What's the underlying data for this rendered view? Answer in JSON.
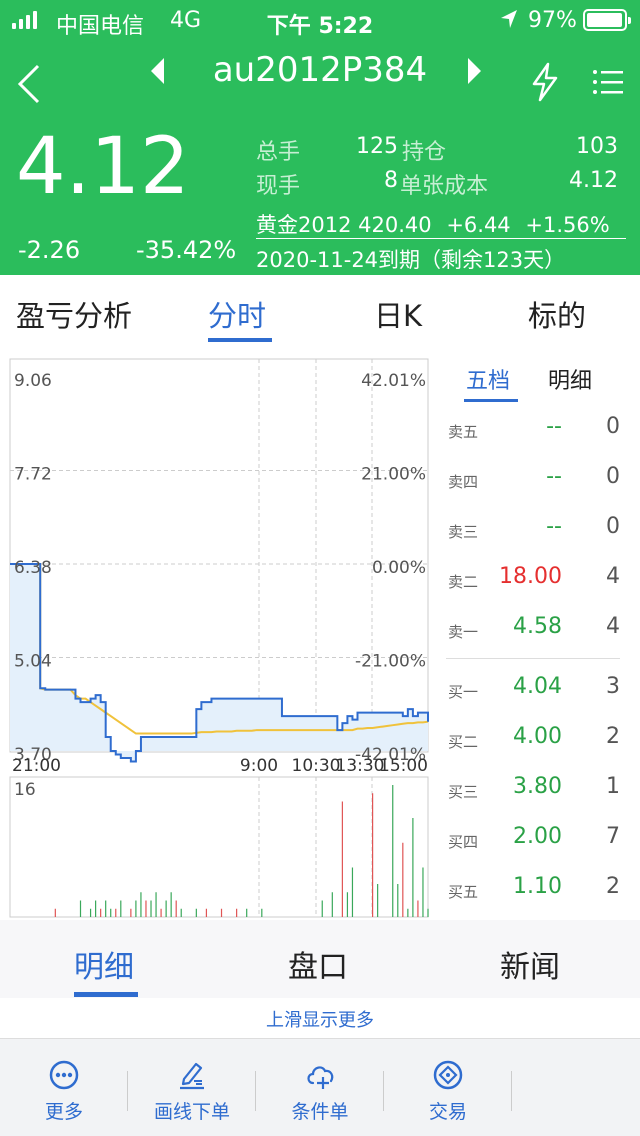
{
  "status_bar": {
    "carrier": "中国电信",
    "network": "4G",
    "time": "下午 5:22",
    "battery": "97%"
  },
  "nav": {
    "symbol": "au2012P384"
  },
  "quote": {
    "price": "4.12",
    "change": "-2.26",
    "change_pct": "-35.42%",
    "total_vol_label": "总手",
    "total_vol": "125",
    "oi_label": "持仓",
    "oi": "103",
    "cur_vol_label": "现手",
    "cur_vol": "8",
    "cost_label": "单张成本",
    "cost": "4.12",
    "underlying": "黄金2012",
    "underlying_price": "420.40",
    "underlying_chg": "+6.44",
    "underlying_pct": "+1.56%",
    "expiry": "2020-11-24到期（剩余123天）"
  },
  "tabs": [
    "盈亏分析",
    "分时",
    "日K",
    "标的"
  ],
  "chart_data": {
    "type": "line",
    "y_left_ticks": [
      "9.06",
      "7.72",
      "6.38",
      "5.04",
      "3.70"
    ],
    "y_right_ticks": [
      "42.01%",
      "21.00%",
      "0.00%",
      "-21.00%",
      "-42.01%"
    ],
    "x_ticks": [
      "21:00",
      "9:00",
      "10:30",
      "13:30",
      "15:00"
    ],
    "ylim": [
      3.7,
      9.06
    ],
    "volume_max_label": "16",
    "series": [
      {
        "values": [
          6.38,
          6.38,
          6.38,
          6.38,
          6.38,
          6.38,
          4.6,
          4.58,
          4.58,
          4.58,
          4.58,
          4.58,
          4.58,
          4.45,
          4.4,
          4.4,
          4.45,
          4.5,
          4.4,
          3.9,
          3.7,
          3.65,
          3.6,
          3.6,
          3.55,
          3.7,
          3.9,
          3.9,
          3.9,
          3.9,
          3.9,
          3.9,
          3.9,
          3.9,
          3.9,
          3.9,
          3.9,
          4.3,
          4.4,
          4.4,
          4.45,
          4.45,
          4.45,
          4.45,
          4.45,
          4.45,
          4.45,
          4.45,
          4.45,
          4.45,
          4.45,
          4.45,
          4.45,
          4.45,
          4.2,
          4.2,
          4.2,
          4.2,
          4.2,
          4.2,
          4.2,
          4.2,
          4.2,
          4.2,
          4.2,
          4.0,
          4.1,
          4.2,
          4.15,
          4.25,
          4.25,
          4.25,
          4.25,
          4.25,
          4.25,
          4.25,
          4.25,
          4.25,
          4.2,
          4.3,
          4.2,
          4.25,
          4.25,
          4.12
        ]
      },
      {
        "values": [
          6.38,
          6.38,
          6.38,
          6.38,
          6.38,
          6.38,
          4.6,
          4.58,
          4.58,
          4.58,
          4.58,
          4.58,
          4.58,
          4.5,
          4.45,
          4.45,
          4.4,
          4.35,
          4.3,
          4.25,
          4.2,
          4.15,
          4.1,
          4.05,
          4.0,
          3.95,
          3.95,
          3.95,
          3.95,
          3.95,
          3.95,
          3.95,
          3.95,
          3.95,
          3.95,
          3.95,
          3.95,
          3.96,
          3.97,
          3.97,
          3.97,
          3.98,
          3.98,
          3.98,
          3.98,
          3.99,
          3.99,
          3.99,
          3.99,
          4.0,
          4.0,
          4.0,
          4.0,
          4.0,
          4.0,
          4.0,
          4.0,
          4.0,
          4.0,
          4.0,
          4.0,
          4.0,
          4.0,
          4.0,
          4.0,
          4.0,
          4.0,
          4.0,
          4.0,
          4.02,
          4.02,
          4.03,
          4.03,
          4.04,
          4.05,
          4.06,
          4.07,
          4.08,
          4.09,
          4.1,
          4.1,
          4.11,
          4.11,
          4.12
        ]
      }
    ],
    "volume": [
      0,
      0,
      0,
      0,
      0,
      0,
      0,
      0,
      0,
      1,
      0,
      0,
      0,
      0,
      2,
      0,
      1,
      2,
      1,
      2,
      1,
      1,
      2,
      0,
      1,
      2,
      3,
      2,
      2,
      3,
      1,
      2,
      3,
      2,
      1,
      0,
      0,
      1,
      0,
      1,
      0,
      0,
      1,
      0,
      0,
      1,
      0,
      1,
      0,
      0,
      1,
      0,
      0,
      0,
      0,
      0,
      0,
      0,
      0,
      0,
      0,
      0,
      2,
      0,
      3,
      0,
      14,
      3,
      6,
      0,
      0,
      0,
      15,
      4,
      0,
      0,
      16,
      4,
      9,
      1,
      12,
      2,
      6,
      1
    ]
  },
  "orderbook": {
    "tabs": [
      "五档",
      "明细"
    ],
    "asks": [
      {
        "label": "卖五",
        "price": "--",
        "vol": "0"
      },
      {
        "label": "卖四",
        "price": "--",
        "vol": "0"
      },
      {
        "label": "卖三",
        "price": "--",
        "vol": "0"
      },
      {
        "label": "卖二",
        "price": "18.00",
        "vol": "4"
      },
      {
        "label": "卖一",
        "price": "4.58",
        "vol": "4"
      }
    ],
    "bids": [
      {
        "label": "买一",
        "price": "4.04",
        "vol": "3"
      },
      {
        "label": "买二",
        "price": "4.00",
        "vol": "2"
      },
      {
        "label": "买三",
        "price": "3.80",
        "vol": "1"
      },
      {
        "label": "买四",
        "price": "2.00",
        "vol": "7"
      },
      {
        "label": "买五",
        "price": "1.10",
        "vol": "2"
      }
    ]
  },
  "bottom_tabs": [
    "明细",
    "盘口",
    "新闻"
  ],
  "more_hint": "上滑显示更多",
  "toolbar": [
    {
      "label": "更多",
      "icon": "more-circle-icon"
    },
    {
      "label": "画线下单",
      "icon": "pen-line-icon"
    },
    {
      "label": "条件单",
      "icon": "cloud-plus-icon"
    },
    {
      "label": "交易",
      "icon": "trade-diamond-icon"
    }
  ],
  "colors": {
    "header_green": "#2bbd5c",
    "accent_blue": "#2f6ccf",
    "up_red": "#e52f2f",
    "down_green": "#2aa146"
  }
}
